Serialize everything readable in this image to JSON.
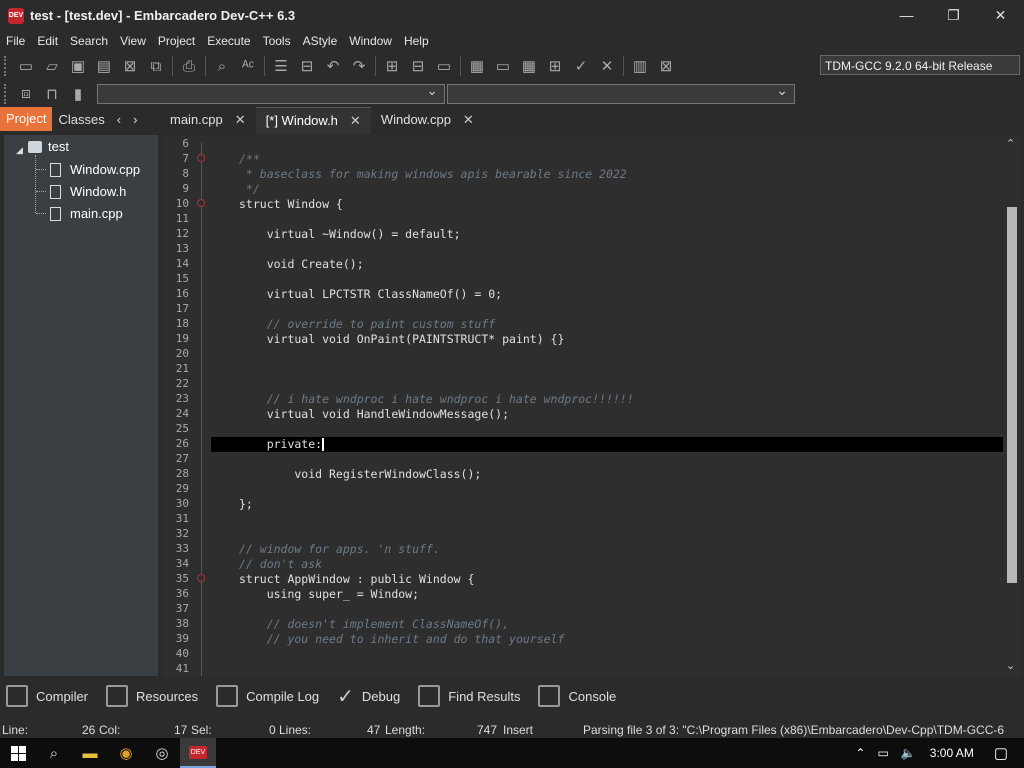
{
  "window": {
    "title": "test - [test.dev] - Embarcadero Dev-C++ 6.3",
    "logo_text": "DEV",
    "minimize": "—",
    "maximize": "❐",
    "close": "✕"
  },
  "menu": [
    "File",
    "Edit",
    "Search",
    "View",
    "Project",
    "Execute",
    "Tools",
    "AStyle",
    "Window",
    "Help"
  ],
  "toolbar": {
    "compiler": "TDM-GCC 9.2.0 64-bit Release"
  },
  "left_panel": {
    "tabs": [
      "Project",
      "Classes"
    ],
    "prev": "‹",
    "next": "›",
    "tree": {
      "root": "test",
      "files": [
        "Window.cpp",
        "Window.h",
        "main.cpp"
      ]
    }
  },
  "editor_tabs": [
    {
      "label": "main.cpp",
      "active": false
    },
    {
      "label": "[*] Window.h",
      "active": true
    },
    {
      "label": "Window.cpp",
      "active": false
    }
  ],
  "editor": {
    "lines": [
      {
        "n": "6",
        "text": ""
      },
      {
        "n": "7",
        "text": "/**"
      },
      {
        "n": "8",
        "text": " * baseclass for making windows apis bearable since 2022"
      },
      {
        "n": "9",
        "text": " */"
      },
      {
        "n": "10",
        "text": "struct Window {"
      },
      {
        "n": "11",
        "text": ""
      },
      {
        "n": "12",
        "text": "    virtual ~Window() = default;"
      },
      {
        "n": "13",
        "text": ""
      },
      {
        "n": "14",
        "text": "    void Create();"
      },
      {
        "n": "15",
        "text": ""
      },
      {
        "n": "16",
        "text": "    virtual LPCTSTR ClassNameOf() = 0;"
      },
      {
        "n": "17",
        "text": ""
      },
      {
        "n": "18",
        "text": "    // override to paint custom stuff"
      },
      {
        "n": "19",
        "text": "    virtual void OnPaint(PAINTSTRUCT* paint) {}"
      },
      {
        "n": "20",
        "text": ""
      },
      {
        "n": "21",
        "text": ""
      },
      {
        "n": "22",
        "text": ""
      },
      {
        "n": "23",
        "text": "    // i hate wndproc i hate wndproc i hate wndproc!!!!!!"
      },
      {
        "n": "24",
        "text": "    virtual void HandleWindowMessage();"
      },
      {
        "n": "25",
        "text": ""
      },
      {
        "n": "26",
        "text": "    private:"
      },
      {
        "n": "27",
        "text": ""
      },
      {
        "n": "28",
        "text": "        void RegisterWindowClass();"
      },
      {
        "n": "29",
        "text": ""
      },
      {
        "n": "30",
        "text": "};"
      },
      {
        "n": "31",
        "text": ""
      },
      {
        "n": "32",
        "text": ""
      },
      {
        "n": "33",
        "text": "// window for apps. 'n stuff."
      },
      {
        "n": "34",
        "text": "// don't ask"
      },
      {
        "n": "35",
        "text": "struct AppWindow : public Window {"
      },
      {
        "n": "36",
        "text": "    using super_ = Window;"
      },
      {
        "n": "37",
        "text": ""
      },
      {
        "n": "38",
        "text": "    // doesn't implement ClassNameOf(),"
      },
      {
        "n": "39",
        "text": "    // you need to inherit and do that yourself"
      },
      {
        "n": "40",
        "text": ""
      },
      {
        "n": "41",
        "text": ""
      }
    ],
    "cursor_line": "26"
  },
  "bottom_tabs": [
    "Compiler",
    "Resources",
    "Compile Log",
    "Debug",
    "Find Results",
    "Console"
  ],
  "status": {
    "line_label": "Line:",
    "line_value": "26",
    "col_label": "Col:",
    "col_value": "17",
    "sel_label": "Sel:",
    "sel_value": "0",
    "lines_label": "Lines:",
    "lines_value": "47",
    "length_label": "Length:",
    "length_value": "747",
    "mode": "Insert",
    "message": "Parsing file 3 of 3: \"C:\\Program Files (x86)\\Embarcadero\\Dev-Cpp\\TDM-GCC-6"
  },
  "taskbar": {
    "clock": "3:00 AM",
    "devcpp_label": "DEV"
  }
}
